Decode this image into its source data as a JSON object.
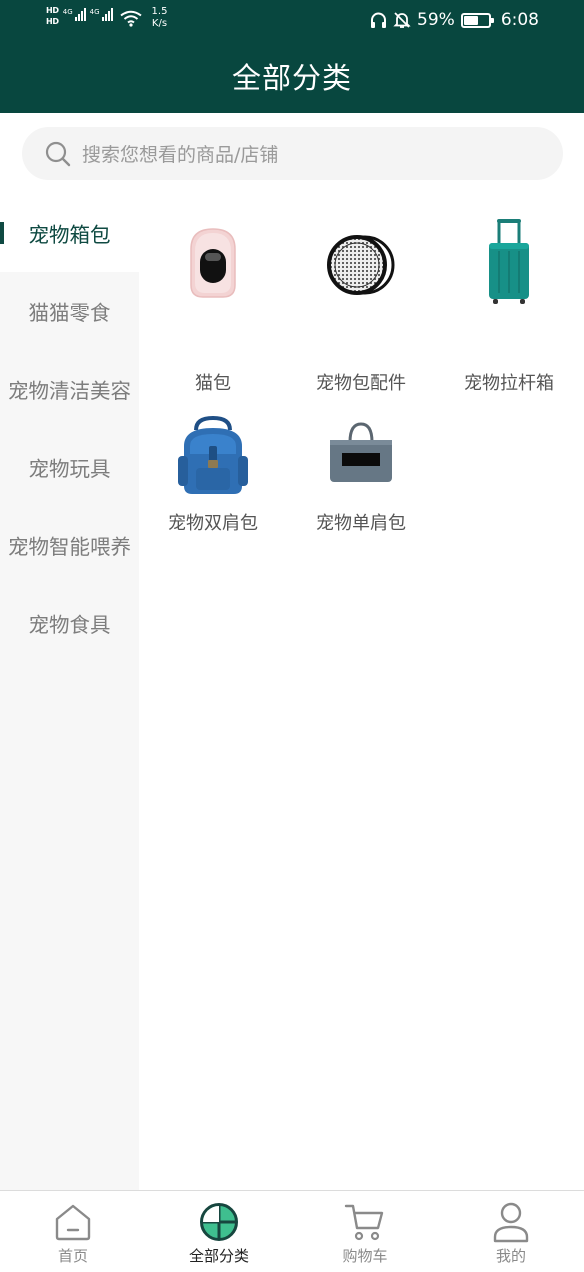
{
  "status_bar": {
    "hd_top": "HD",
    "hd_bottom": "HD",
    "sig1_label": "4G",
    "sig2_label": "4G",
    "net_speed_value": "1.5",
    "net_speed_unit": "K/s",
    "battery_percent": "59%",
    "battery_level": 0.59,
    "time": "6:08"
  },
  "header": {
    "title": "全部分类"
  },
  "search": {
    "placeholder": "搜索您想看的商品/店铺"
  },
  "sidebar": {
    "items": [
      {
        "label": "宠物箱包",
        "active": true
      },
      {
        "label": "猫猫零食",
        "active": false
      },
      {
        "label": "宠物清洁美容",
        "active": false
      },
      {
        "label": "宠物玩具",
        "active": false
      },
      {
        "label": "宠物智能喂养",
        "active": false
      },
      {
        "label": "宠物食具",
        "active": false
      }
    ]
  },
  "products": [
    {
      "name": "猫包",
      "icon": "cat-carrier-icon"
    },
    {
      "name": "宠物包配件",
      "icon": "carrier-accessory-icon"
    },
    {
      "name": "宠物拉杆箱",
      "icon": "trolley-case-icon"
    },
    {
      "name": "宠物双肩包",
      "icon": "backpack-icon"
    },
    {
      "name": "宠物单肩包",
      "icon": "shoulder-bag-icon"
    }
  ],
  "tabbar": {
    "tabs": [
      {
        "label": "首页",
        "icon": "home-icon",
        "active": false
      },
      {
        "label": "全部分类",
        "icon": "category-icon",
        "active": true
      },
      {
        "label": "购物车",
        "icon": "cart-icon",
        "active": false
      },
      {
        "label": "我的",
        "icon": "user-icon",
        "active": false
      }
    ]
  },
  "colors": {
    "header_bg": "#08473f",
    "accent": "#0f4a42",
    "sidebar_bg": "#f7f7f7",
    "search_bg": "#f4f4f4"
  }
}
